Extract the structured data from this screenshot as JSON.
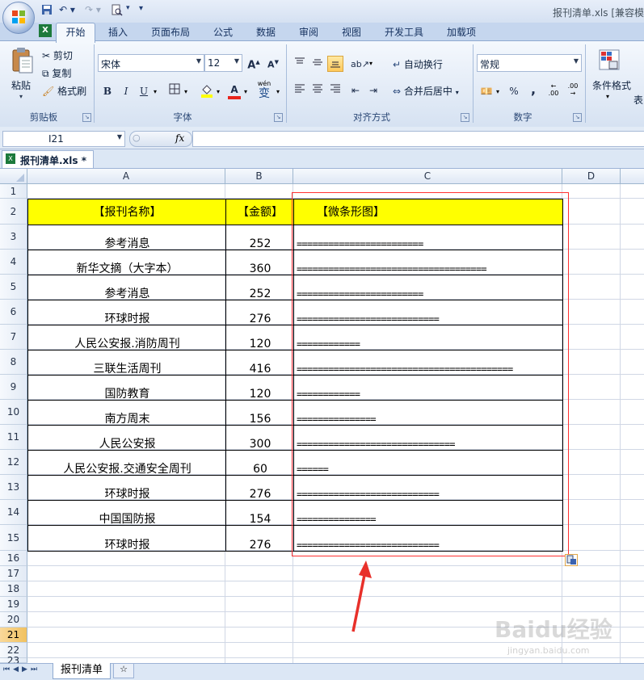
{
  "window": {
    "title": "报刊清单.xls  [兼容模"
  },
  "ribbon": {
    "tabs": [
      "开始",
      "插入",
      "页面布局",
      "公式",
      "数据",
      "审阅",
      "视图",
      "开发工具",
      "加载项"
    ],
    "clipboard": {
      "paste": "粘贴",
      "cut": "剪切",
      "copy": "复制",
      "format_painter": "格式刷",
      "label": "剪贴板"
    },
    "font": {
      "name": "宋体",
      "size": "12",
      "label": "字体",
      "bold": "B",
      "italic": "I",
      "underline": "U",
      "grow": "A",
      "shrink": "A",
      "font_color": "A",
      "phonetic": "wén",
      "phonetic_char": "变"
    },
    "alignment": {
      "wrap": "自动换行",
      "merge": "合并后居中",
      "label": "对齐方式"
    },
    "number": {
      "format": "常规",
      "percent": "%",
      "comma": ",",
      "inc": ".00",
      "dec": ".00",
      "label": "数字"
    },
    "styles": {
      "conditional": "条件格式",
      "table": "表"
    }
  },
  "formula_bar": {
    "name_box": "I21",
    "fx": "fx",
    "value": ""
  },
  "workbook_tab": {
    "label": "报刊清单.xls *"
  },
  "sheet": {
    "columns": [
      "A",
      "B",
      "C",
      "D"
    ],
    "header": {
      "name": "【报刊名称】",
      "amount": "【金额】",
      "bar": "【微条形图】"
    },
    "rows": [
      {
        "name": "参考消息",
        "amount": "252",
        "bar": "========================"
      },
      {
        "name": "新华文摘（大字本）",
        "amount": "360",
        "bar": "===================================="
      },
      {
        "name": "参考消息",
        "amount": "252",
        "bar": "========================"
      },
      {
        "name": "环球时报",
        "amount": "276",
        "bar": "==========================="
      },
      {
        "name": "人民公安报.消防周刊",
        "amount": "120",
        "bar": "============"
      },
      {
        "name": "三联生活周刊",
        "amount": "416",
        "bar": "========================================="
      },
      {
        "name": "国防教育",
        "amount": "120",
        "bar": "============"
      },
      {
        "name": "南方周末",
        "amount": "156",
        "bar": "==============="
      },
      {
        "name": "人民公安报",
        "amount": "300",
        "bar": "=============================="
      },
      {
        "name": "人民公安报.交通安全周刊",
        "amount": "60",
        "bar": "======"
      },
      {
        "name": "环球时报",
        "amount": "276",
        "bar": "==========================="
      },
      {
        "name": "中国国防报",
        "amount": "154",
        "bar": "==============="
      },
      {
        "name": "环球时报",
        "amount": "276",
        "bar": "==========================="
      }
    ],
    "row_numbers": [
      "1",
      "2",
      "3",
      "4",
      "5",
      "6",
      "7",
      "8",
      "9",
      "10",
      "11",
      "12",
      "13",
      "14",
      "15",
      "16",
      "17",
      "18",
      "19",
      "20",
      "21",
      "22",
      "23"
    ],
    "selected_row": "21"
  },
  "sheet_tabs": {
    "active": "报刊清单"
  },
  "watermark": {
    "brand": "Baidu经验",
    "url": "jingyan.baidu.com"
  },
  "colors": {
    "header_fill": "#ffff00",
    "annotation": "#ff3030",
    "ribbon_bg": "#dbe5f4"
  }
}
